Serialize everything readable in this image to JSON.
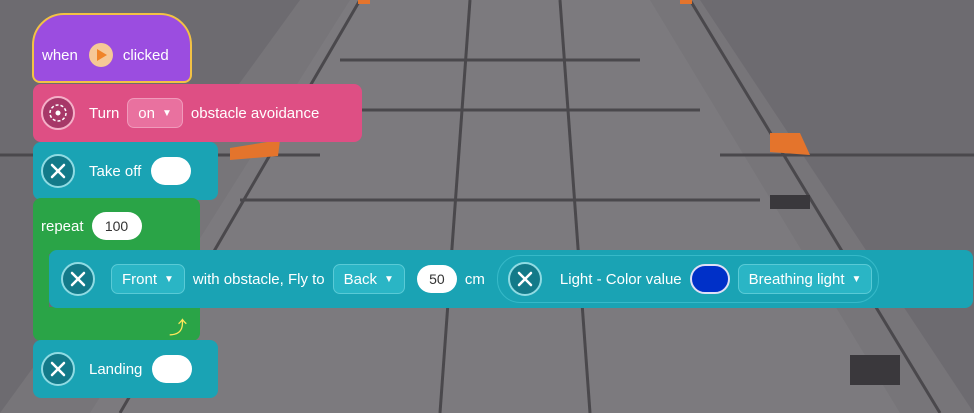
{
  "hat": {
    "when": "when",
    "clicked": "clicked"
  },
  "avoidance": {
    "turn": "Turn",
    "state": "on",
    "label": "obstacle avoidance"
  },
  "takeoff": {
    "label": "Take off"
  },
  "repeat": {
    "label": "repeat",
    "count": "100"
  },
  "fly": {
    "direction": "Front",
    "text": "with obstacle, Fly to",
    "target": "Back",
    "distance": "50",
    "unit": "cm",
    "light_label": "Light - Color value",
    "light_color": "#0030c8",
    "light_mode": "Breathing light"
  },
  "landing": {
    "label": "Landing"
  },
  "icons": {
    "hat": "play-icon",
    "avoid": "radar-icon",
    "drone": "drone-icon",
    "repeat": "loop-arrow-icon",
    "caret": "caret-down-icon"
  }
}
